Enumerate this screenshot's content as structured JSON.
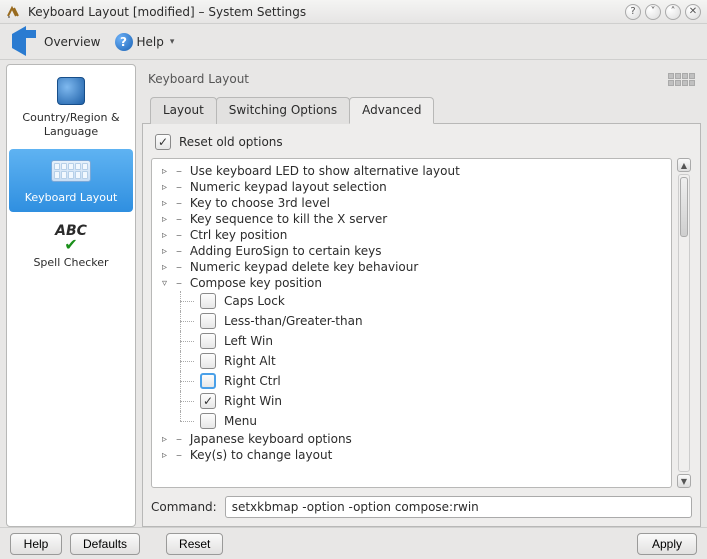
{
  "window": {
    "title": "Keyboard Layout [modified] – System Settings"
  },
  "toolbar": {
    "overview": "Overview",
    "help": "Help"
  },
  "sidebar": {
    "items": [
      {
        "label": "Country/Region & Language"
      },
      {
        "label": "Keyboard Layout"
      },
      {
        "label": "Spell Checker"
      }
    ]
  },
  "section": {
    "title": "Keyboard Layout"
  },
  "tabs": {
    "items": [
      {
        "label": "Layout"
      },
      {
        "label": "Switching Options"
      },
      {
        "label": "Advanced"
      }
    ],
    "active": 2
  },
  "advanced": {
    "reset_old_options": {
      "label": "Reset old options",
      "checked": true
    },
    "tree": [
      {
        "label": "Use keyboard LED to show alternative layout",
        "expanded": false
      },
      {
        "label": "Numeric keypad layout selection",
        "expanded": false
      },
      {
        "label": "Key to choose 3rd level",
        "expanded": false
      },
      {
        "label": "Key sequence to kill the X server",
        "expanded": false
      },
      {
        "label": "Ctrl key position",
        "expanded": false
      },
      {
        "label": "Adding EuroSign to certain keys",
        "expanded": false
      },
      {
        "label": "Numeric keypad delete key behaviour",
        "expanded": false
      },
      {
        "label": "Compose key position",
        "expanded": true,
        "children": [
          {
            "label": "Caps Lock",
            "checked": false
          },
          {
            "label": "Less-than/Greater-than",
            "checked": false
          },
          {
            "label": "Left Win",
            "checked": false
          },
          {
            "label": "Right Alt",
            "checked": false
          },
          {
            "label": "Right Ctrl",
            "checked": false,
            "focus": true
          },
          {
            "label": "Right Win",
            "checked": true
          },
          {
            "label": "Menu",
            "checked": false
          }
        ]
      },
      {
        "label": "Japanese keyboard options",
        "expanded": false
      },
      {
        "label": "Key(s) to change layout",
        "expanded": false
      }
    ]
  },
  "command": {
    "label": "Command:",
    "value": "setxkbmap -option -option compose:rwin"
  },
  "footer": {
    "help": "Help",
    "defaults": "Defaults",
    "reset": "Reset",
    "apply": "Apply"
  }
}
